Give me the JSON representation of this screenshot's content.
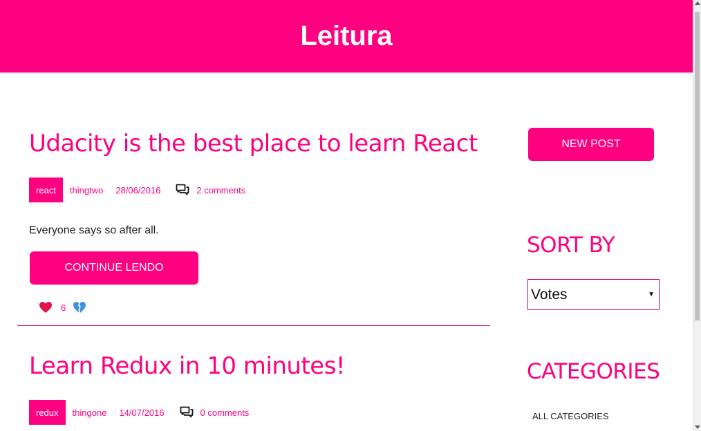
{
  "header": {
    "title": "Leitura"
  },
  "posts": [
    {
      "title": "Udacity is the best place to learn React",
      "category": "react",
      "author": "thingtwo",
      "date": "28/06/2016",
      "comments": "2 comments",
      "body": "Everyone says so after all.",
      "continue_label": "CONTINUE LENDO",
      "votes": "6",
      "upvote_icon": "heart-icon",
      "downvote_icon": "broken-heart-icon"
    },
    {
      "title": "Learn Redux in 10 minutes!",
      "category": "redux",
      "author": "thingone",
      "date": "14/07/2016",
      "comments": "0 comments"
    }
  ],
  "sidebar": {
    "new_post_label": "NEW POST",
    "sort_heading": "SORT BY",
    "sort_selected": "Votes",
    "categories_heading": "CATEGORIES",
    "categories": [
      "ALL CATEGORIES"
    ]
  },
  "colors": {
    "brand": "#ff0080",
    "divider": "#cc0066",
    "heart": "#e0144c",
    "broken_heart": "#3d8fe0"
  }
}
